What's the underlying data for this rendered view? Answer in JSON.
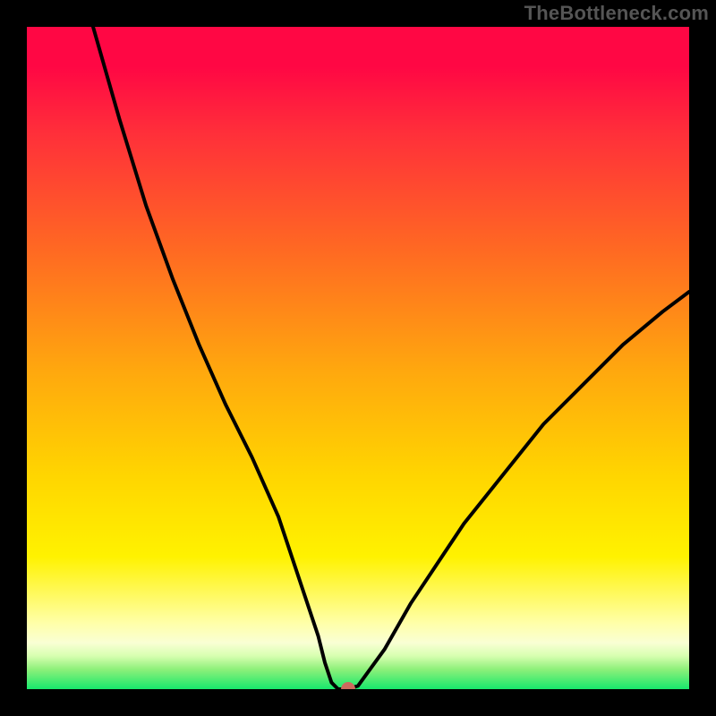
{
  "watermark": "TheBottleneck.com",
  "colors": {
    "frame": "#000000",
    "curve": "#000000",
    "marker": "#cd6a5d",
    "gradient_stops": [
      "#ff0744",
      "#ff2f3a",
      "#ff6a22",
      "#ffa80e",
      "#ffd600",
      "#fff200",
      "#ffffa8",
      "#f9ffd4",
      "#d7ffb0",
      "#8ef07a",
      "#17e86c"
    ]
  },
  "chart_data": {
    "type": "line",
    "title": "",
    "xlabel": "",
    "ylabel": "",
    "xlim": [
      0,
      100
    ],
    "ylim": [
      0,
      100
    ],
    "series": [
      {
        "name": "curve",
        "x": [
          10,
          14,
          18,
          22,
          26,
          30,
          34,
          38,
          40,
          42,
          44,
          45,
          46,
          47,
          48.5,
          50,
          54,
          58,
          62,
          66,
          70,
          74,
          78,
          84,
          90,
          96,
          100
        ],
        "y": [
          100,
          86,
          73,
          62,
          52,
          43,
          35,
          26,
          20,
          14,
          8,
          4,
          1,
          0,
          0,
          0.5,
          6,
          13,
          19,
          25,
          30,
          35,
          40,
          46,
          52,
          57,
          60
        ]
      }
    ],
    "marker": {
      "x": 48.5,
      "y": 0
    },
    "notes": "Axes are unlabeled; values are read as percentages (0-100) of the plotting area. The vertical axis (distance from the green zone) runs upward. The single black curve descends steeply from the upper-left, reaches near zero around x≈47-50 (flat floor segment), then rises with a gentler slope toward the right edge. A small pink marker sits at the curve's minimum."
  }
}
